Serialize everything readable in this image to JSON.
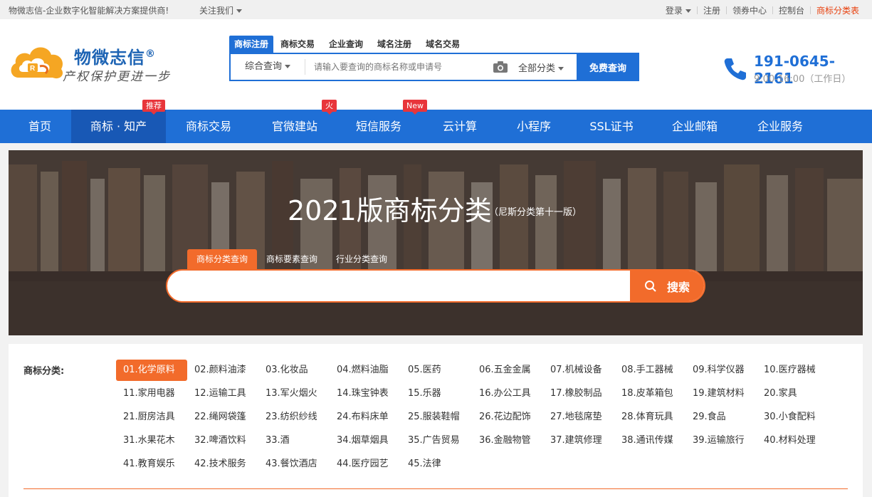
{
  "topbar": {
    "site_name": "物微志信-企业数字化智能解决方案提供商!",
    "follow": "关注我们",
    "login": "登录",
    "register": "注册",
    "coupon": "领券中心",
    "console": "控制台",
    "classification_table": "商标分类表"
  },
  "logo": {
    "title": "物微志信",
    "reg_mark": "®",
    "slogan": "产权保护更进一步"
  },
  "header_search": {
    "tabs": [
      "商标注册",
      "商标交易",
      "企业查询",
      "域名注册",
      "域名交易"
    ],
    "query_type": "综合查询",
    "placeholder": "请输入要查询的商标名称或申请号",
    "category": "全部分类",
    "button": "免费查询"
  },
  "phone": {
    "number": "191-0645-2161",
    "hours": "9:00-16:00（工作日）"
  },
  "nav": {
    "items": [
      "首页",
      "商标 · 知产",
      "商标交易",
      "官微建站",
      "短信服务",
      "云计算",
      "小程序",
      "SSL证书",
      "企业邮箱",
      "企业服务"
    ],
    "badges": {
      "recommend": "推荐",
      "hot": "火",
      "new": "New"
    }
  },
  "banner": {
    "title": "2021版商标分类",
    "subtitle": "（尼斯分类第十一版）",
    "tabs": [
      "商标分类查询",
      "商标要素查询",
      "行业分类查询"
    ],
    "search_value": "",
    "button": "搜索"
  },
  "categories": {
    "label": "商标分类:",
    "items": [
      "01.化学原料",
      "02.颜料油漆",
      "03.化妆品",
      "04.燃料油脂",
      "05.医药",
      "06.五金金属",
      "07.机械设备",
      "08.手工器械",
      "09.科学仪器",
      "10.医疗器械",
      "11.家用电器",
      "12.运输工具",
      "13.军火烟火",
      "14.珠宝钟表",
      "15.乐器",
      "16.办公工具",
      "17.橡胶制品",
      "18.皮革箱包",
      "19.建筑材料",
      "20.家具",
      "21.厨房洁具",
      "22.绳网袋篷",
      "23.纺织纱线",
      "24.布料床单",
      "25.服装鞋帽",
      "26.花边配饰",
      "27.地毯席垫",
      "28.体育玩具",
      "29.食品",
      "30.小食配料",
      "31.水果花木",
      "32.啤酒饮料",
      "33.酒",
      "34.烟草烟具",
      "35.广告贸易",
      "36.金融物管",
      "37.建筑修理",
      "38.通讯传媒",
      "39.运输旅行",
      "40.材料处理",
      "41.教育娱乐",
      "42.技术服务",
      "43.餐饮酒店",
      "44.医疗园艺",
      "45.法律"
    ]
  },
  "colors": {
    "primary_blue": "#1f6fd6",
    "accent_orange": "#f26b2b",
    "badge_red": "#e8353b"
  }
}
